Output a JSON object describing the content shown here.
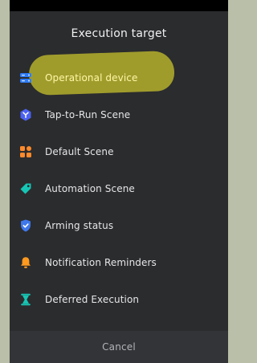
{
  "sheet": {
    "title": "Execution target",
    "items": [
      {
        "label": "Operational device",
        "icon": "device-stack-icon"
      },
      {
        "label": "Tap-to-Run Scene",
        "icon": "tap-to-run-icon"
      },
      {
        "label": "Default Scene",
        "icon": "scene-grid-icon"
      },
      {
        "label": "Automation Scene",
        "icon": "tag-icon"
      },
      {
        "label": "Arming status",
        "icon": "shield-check-icon"
      },
      {
        "label": "Notification Reminders",
        "icon": "bell-icon"
      },
      {
        "label": "Deferred Execution",
        "icon": "hourglass-icon"
      }
    ],
    "cancel_label": "Cancel"
  },
  "colors": {
    "background": "#b9bfa8",
    "sheet": "#2b2c2e",
    "highlight": "#cdc82d",
    "cancel_bar": "#333437",
    "device_icon": "#2f7bf6",
    "tap_icon": "#4b62f2",
    "scene_icon": "#ff8a2b",
    "tag_icon": "#16c6b5",
    "shield_icon": "#3f78ea",
    "bell_icon": "#ff9a1f",
    "hourglass_icon": "#17c6b3"
  }
}
